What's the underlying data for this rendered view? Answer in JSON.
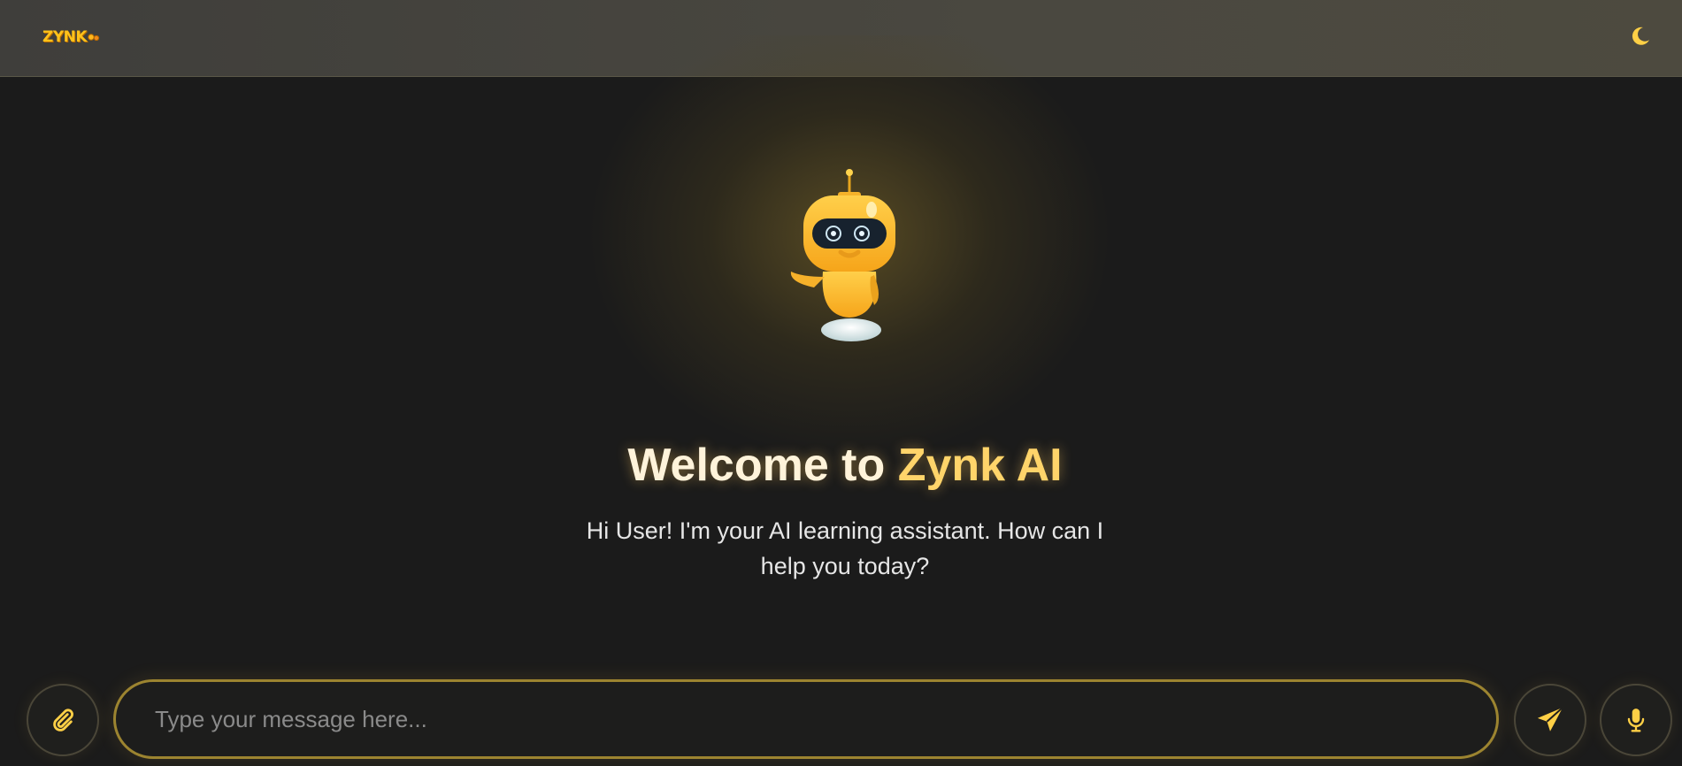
{
  "header": {
    "logo_text": "ZYNK",
    "logo_icon": "zynk-logo-mark",
    "theme_toggle_icon": "moon-icon"
  },
  "hero": {
    "mascot_icon": "robot-mascot",
    "welcome_prefix": "Welcome to ",
    "welcome_brand": "Zynk AI",
    "subtitle": "Hi User! I'm your AI learning assistant. How can I help you today?"
  },
  "composer": {
    "attach_icon": "paperclip-icon",
    "placeholder": "Type your message here...",
    "value": "",
    "send_icon": "paper-plane-icon",
    "mic_icon": "microphone-icon"
  },
  "colors": {
    "accent": "#ffd46a",
    "background": "#1b1b1b",
    "topbar": "#45433c",
    "input_border": "#9c8430"
  }
}
